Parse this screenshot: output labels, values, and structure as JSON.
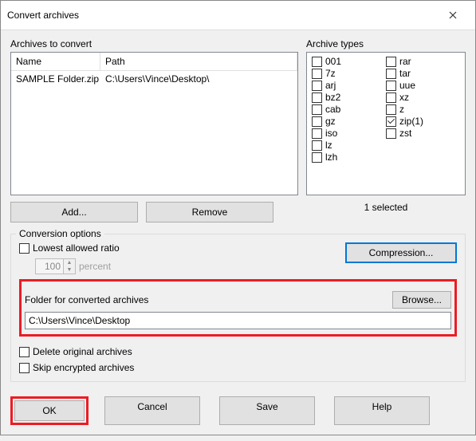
{
  "window": {
    "title": "Convert archives"
  },
  "archives": {
    "label": "Archives to convert",
    "headers": {
      "name": "Name",
      "path": "Path"
    },
    "rows": [
      {
        "name": "SAMPLE Folder.zip",
        "path": "C:\\Users\\Vince\\Desktop\\"
      }
    ],
    "add_label": "Add...",
    "remove_label": "Remove"
  },
  "types": {
    "label": "Archive types",
    "col1": [
      "001",
      "7z",
      "arj",
      "bz2",
      "cab",
      "gz",
      "iso",
      "lz",
      "lzh"
    ],
    "col2": [
      "rar",
      "tar",
      "uue",
      "xz",
      "z",
      "zip(1)",
      "zst"
    ],
    "checked": "zip(1)",
    "selected_text": "1 selected"
  },
  "options": {
    "legend": "Conversion options",
    "lowest_ratio_label": "Lowest allowed ratio",
    "ratio_value": "100",
    "percent_label": "percent",
    "compression_label": "Compression...",
    "folder_label": "Folder for converted archives",
    "browse_label": "Browse...",
    "folder_value": "C:\\Users\\Vince\\Desktop",
    "delete_label": "Delete original archives",
    "skip_label": "Skip encrypted archives"
  },
  "buttons": {
    "ok": "OK",
    "cancel": "Cancel",
    "save": "Save",
    "help": "Help"
  }
}
